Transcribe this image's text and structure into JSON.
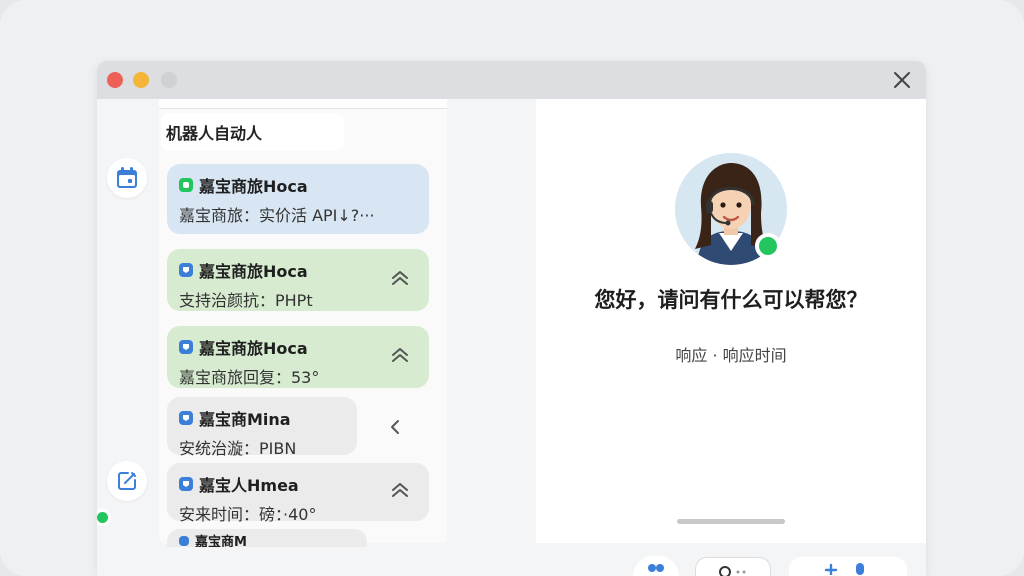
{
  "window": {
    "controls": [
      "close-dot",
      "minimize-dot",
      "maximize-dot"
    ],
    "close_icon": "close-icon"
  },
  "sidebar": {
    "header_label": "机器人自动人",
    "icons": [
      "calendar-icon",
      "edit-icon"
    ],
    "status_color": "#22c55e"
  },
  "conversations": [
    {
      "title": "嘉宝商旅Hoca",
      "preview": "嘉宝商旅：实价活 API↓?···",
      "color": "blue",
      "icon_color": "#22c55e",
      "chevron": ""
    },
    {
      "title": "嘉宝商旅Hoca",
      "preview": "支持治颜抗：PHPt",
      "color": "green",
      "icon_color": "#3b7fd9",
      "chevron": "chevron-up-icon"
    },
    {
      "title": "嘉宝商旅Hoca",
      "preview": "嘉宝商旅回复：53°",
      "color": "green",
      "icon_color": "#3b7fd9",
      "chevron": "chevron-up-icon"
    },
    {
      "title": "嘉宝商Mina",
      "preview": "安统治漩：PIBN",
      "color": "gray",
      "icon_color": "#3b7fd9",
      "chevron": "chevron-left-icon"
    },
    {
      "title": "嘉宝人Hmea",
      "preview": "安来时间：磅：·40°",
      "color": "gray",
      "icon_color": "#3b7fd9",
      "chevron": "chevron-up-icon"
    },
    {
      "title": "嘉宝商M",
      "preview": "",
      "color": "gray",
      "icon_color": "#3b7fd9",
      "chevron": ""
    }
  ],
  "assistant": {
    "greeting": "您好，请问有什么可以帮您？",
    "subtext": "响应 · 响应时间",
    "online_color": "#22c55e"
  },
  "colors": {
    "blue_card": "#d8e6f3",
    "green_card": "#d6ebcf",
    "gray_card": "#ebebeb",
    "accent_blue": "#3b7fd9"
  }
}
